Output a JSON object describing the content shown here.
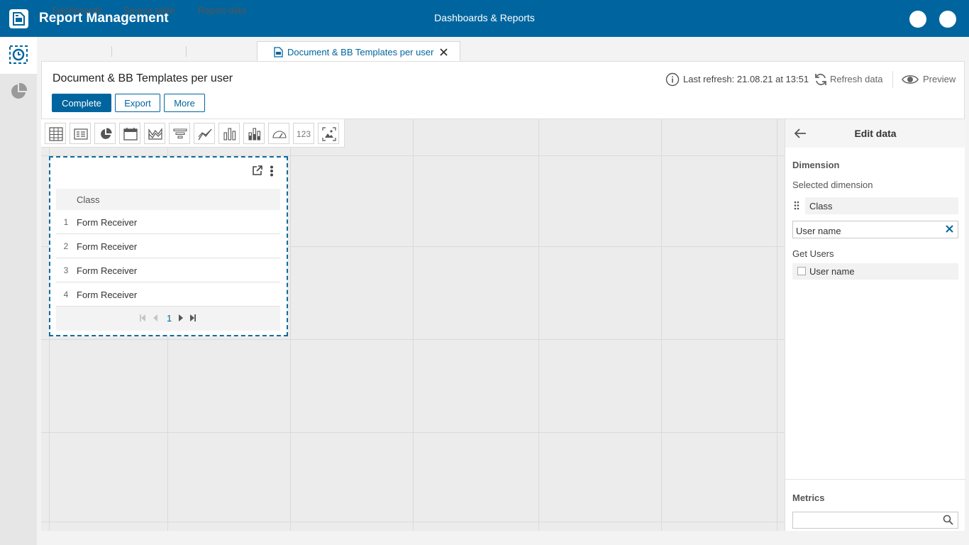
{
  "app": {
    "title": "Report Management",
    "center_title": "Dashboards & Reports"
  },
  "tabs": [
    {
      "label": "Dashboards"
    },
    {
      "label": "Source table"
    },
    {
      "label": "Report data"
    },
    {
      "label": "Document & BB Templates per user",
      "active": true
    }
  ],
  "header": {
    "title": "Document & BB Templates per user",
    "buttons": {
      "complete": "Complete",
      "export": "Export",
      "more": "More"
    },
    "last_refresh": "Last refresh: 21.08.21 at 13:51",
    "refresh_label": "Refresh data",
    "preview_label": "Preview"
  },
  "toolbar": {
    "tools": [
      "table-icon",
      "pivot-icon",
      "pie-chart-icon",
      "calendar-icon",
      "area-chart-icon",
      "funnel-icon",
      "line-chart-icon",
      "bar-chart-icon",
      "stacked-bar-icon",
      "gauge-icon",
      "number-kpi",
      "image-icon"
    ],
    "kpi_label": "123"
  },
  "widget": {
    "column_header": "Class",
    "rows": [
      {
        "num": "1",
        "value": "Form Receiver"
      },
      {
        "num": "2",
        "value": "Form Receiver"
      },
      {
        "num": "3",
        "value": "Form Receiver"
      },
      {
        "num": "4",
        "value": "Form Receiver"
      }
    ],
    "current_page": "1"
  },
  "edit_panel": {
    "title": "Edit data",
    "dimension_section": "Dimension",
    "selected_dimension_label": "Selected dimension",
    "selected_dimension": "Class",
    "search_value": "User name",
    "group_label": "Get Users",
    "option_label": "User name",
    "metrics_section": "Metrics",
    "metrics_search_value": ""
  },
  "colors": {
    "brand": "#00659e",
    "canvas": "#ececec"
  }
}
